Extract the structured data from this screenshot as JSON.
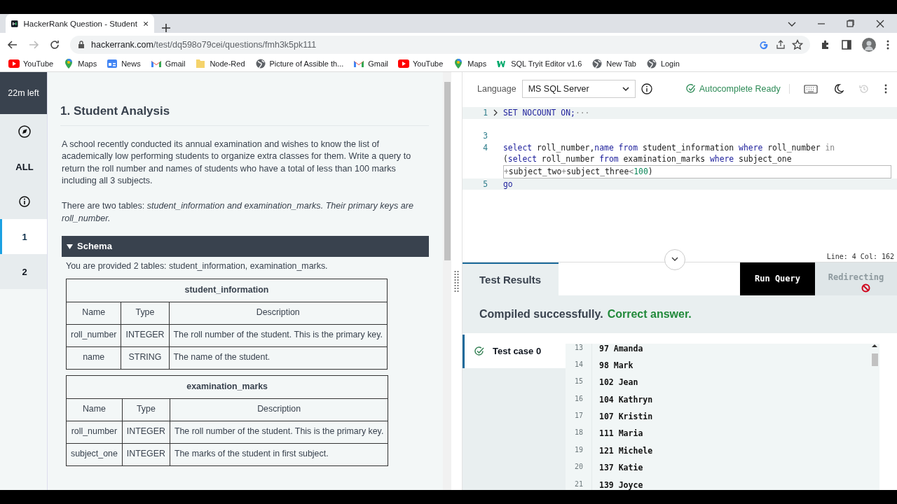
{
  "browser": {
    "tab_title": "HackerRank Question - Student",
    "url_host": "hackerrank.com",
    "url_path": "/test/dq598o79cei/questions/fmh3k5pk111",
    "bookmarks": [
      {
        "label": "YouTube",
        "kind": "youtube"
      },
      {
        "label": "Maps",
        "kind": "maps"
      },
      {
        "label": "News",
        "kind": "news"
      },
      {
        "label": "Gmail",
        "kind": "gmail"
      },
      {
        "label": "Node-Red",
        "kind": "folder"
      },
      {
        "label": "Picture of Assible th...",
        "kind": "globe"
      },
      {
        "label": "Gmail",
        "kind": "gmail"
      },
      {
        "label": "YouTube",
        "kind": "youtube"
      },
      {
        "label": "Maps",
        "kind": "maps"
      },
      {
        "label": "SQL Tryit Editor v1.6",
        "kind": "w3"
      },
      {
        "label": "New Tab",
        "kind": "globe"
      },
      {
        "label": "Login",
        "kind": "globe"
      }
    ]
  },
  "sidebar": {
    "timer": "22m left",
    "items": [
      {
        "kind": "compass",
        "selected": false
      },
      {
        "kind": "text",
        "label": "ALL",
        "selected": false
      },
      {
        "kind": "info",
        "selected": false
      },
      {
        "kind": "text",
        "label": "1",
        "selected": true
      },
      {
        "kind": "text",
        "label": "2",
        "selected": false
      }
    ]
  },
  "question": {
    "title": "1. Student Analysis",
    "paragraphs": [
      "A school recently conducted its annual examination and wishes to know the list of academically low performing students to organize extra classes for them. Write a query to return the roll number and names of students who have a total of less than 100 marks including all 3 subjects.",
      "There are two tables: *student_information and examination_marks. Their primary keys are roll_number.*"
    ],
    "schema": {
      "title": "Schema",
      "expanded": true,
      "intro": "You are provided 2 tables: student_information, examination_marks.",
      "tables": [
        {
          "name": "student_information",
          "columns": [
            "Name",
            "Type",
            "Description"
          ],
          "rows": [
            [
              "roll_number",
              "INTEGER",
              "The roll number of the student. This is the primary key."
            ],
            [
              "name",
              "STRING",
              "The name of the student."
            ]
          ]
        },
        {
          "name": "examination_marks",
          "columns": [
            "Name",
            "Type",
            "Description"
          ],
          "rows": [
            [
              "roll_number",
              "INTEGER",
              "The roll number of the student. This is the primary key."
            ],
            [
              "subject_one",
              "INTEGER",
              "The marks of the student in first subject."
            ]
          ]
        }
      ]
    }
  },
  "editor": {
    "language_label": "Language",
    "language": "MS SQL Server",
    "autocomplete": "Autocomplete Ready",
    "autocomplete_ready": true,
    "lines": [
      {
        "number": "1",
        "folded": true,
        "highlighted": true,
        "rows": [
          {
            "tokens": [
              {
                "text": "SET NOCOUNT ON;",
                "kind": "keyword"
              },
              {
                "text": "···",
                "kind": "ellipsis"
              }
            ]
          }
        ]
      },
      {
        "number": "3",
        "folded": false,
        "highlighted": false
      },
      {
        "number": "4",
        "folded": false,
        "highlighted": false,
        "rows": [
          {
            "tokens": [
              {
                "text": "select",
                "kind": "keyword"
              },
              {
                "text": " roll_number,",
                "kind": "plain"
              },
              {
                "text": "name",
                "kind": "keyword"
              },
              {
                "text": " from",
                "kind": "keyword"
              },
              {
                "text": " student_information",
                "kind": "plain"
              },
              {
                "text": " where",
                "kind": "keyword"
              },
              {
                "text": " roll_number",
                "kind": "plain"
              },
              {
                "text": " in",
                "kind": "operator"
              }
            ]
          },
          {
            "tokens": [
              {
                "text": "(",
                "kind": "plain"
              },
              {
                "text": "select",
                "kind": "keyword"
              },
              {
                "text": " roll_number",
                "kind": "plain"
              },
              {
                "text": " from",
                "kind": "keyword"
              },
              {
                "text": " examination_marks",
                "kind": "plain"
              },
              {
                "text": " where",
                "kind": "keyword"
              },
              {
                "text": " subject_one",
                "kind": "plain"
              }
            ]
          },
          {
            "tokens": [
              {
                "text": "+",
                "kind": "operator"
              },
              {
                "text": "subject_two",
                "kind": "plain"
              },
              {
                "text": "+",
                "kind": "operator"
              },
              {
                "text": "subject_three",
                "kind": "plain"
              },
              {
                "text": "<",
                "kind": "operator"
              },
              {
                "text": "100",
                "kind": "number"
              },
              {
                "text": ")",
                "kind": "plain"
              }
            ]
          }
        ]
      },
      {
        "number": "5",
        "folded": false,
        "highlighted": true,
        "rows": [
          {
            "tokens": [
              {
                "text": "go",
                "kind": "keyword"
              }
            ]
          }
        ]
      }
    ],
    "cursor": "Line: 4 Col: 162"
  },
  "results": {
    "tab": "Test Results",
    "run_button": "Run Query",
    "submit_button": "Redirecting",
    "submit_disabled": true,
    "status": "Compiled successfully.",
    "verdict": "Correct answer.",
    "test_cases": [
      {
        "label": "Test case 0",
        "passed": true,
        "selected": true
      }
    ],
    "output_lines": [
      {
        "number": "13",
        "text": "97 Amanda"
      },
      {
        "number": "14",
        "text": "98 Mark"
      },
      {
        "number": "15",
        "text": "102 Jean"
      },
      {
        "number": "16",
        "text": "104 Kathryn"
      },
      {
        "number": "17",
        "text": "107 Kristin"
      },
      {
        "number": "18",
        "text": "111 Maria"
      },
      {
        "number": "19",
        "text": "121 Michele"
      },
      {
        "number": "20",
        "text": "137 Katie"
      },
      {
        "number": "21",
        "text": "139 Joyce"
      }
    ]
  }
}
